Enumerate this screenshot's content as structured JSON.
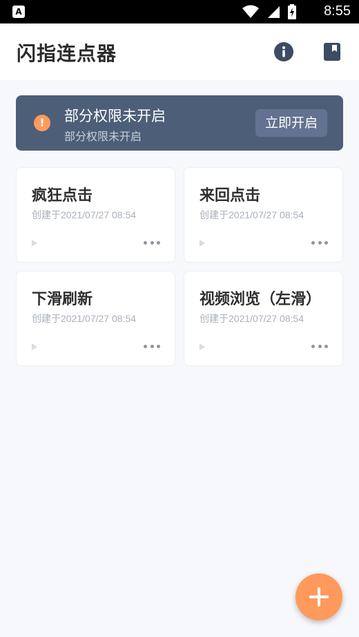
{
  "status_bar": {
    "time": "8:55",
    "app_badge": "A"
  },
  "header": {
    "title": "闪指连点器"
  },
  "banner": {
    "title": "部分权限未开启",
    "subtitle": "部分权限未开启",
    "button_label": "立即开启"
  },
  "cards": [
    {
      "title": "疯狂点击",
      "created": "创建于2021/07/27 08:54"
    },
    {
      "title": "来回点击",
      "created": "创建于2021/07/27 08:54"
    },
    {
      "title": "下滑刷新",
      "created": "创建于2021/07/27 08:54"
    },
    {
      "title": "视频浏览（左滑）",
      "created": "创建于2021/07/27 08:54"
    }
  ],
  "colors": {
    "accent": "#ff9a5c",
    "banner": "#4d5e78",
    "header_icon": "#3d4b63"
  },
  "icons": [
    "info-icon",
    "bookmark-icon",
    "warning-icon",
    "play-icon",
    "more-icon",
    "plus-icon"
  ]
}
